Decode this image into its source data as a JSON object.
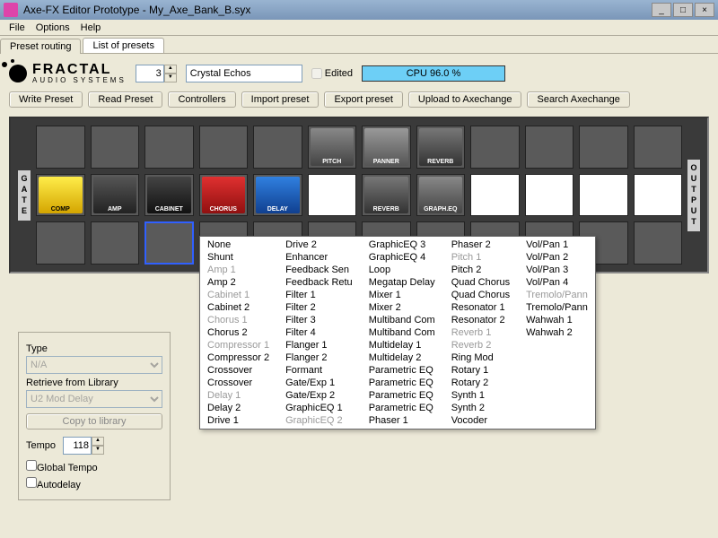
{
  "window": {
    "title": "Axe-FX Editor Prototype - My_Axe_Bank_B.syx"
  },
  "menu": [
    "File",
    "Options",
    "Help"
  ],
  "tabs": [
    "Preset routing",
    "List of presets"
  ],
  "logo": {
    "brand": "FRACTAL",
    "sub": "AUDIO SYSTEMS"
  },
  "preset": {
    "number": "3",
    "name": "Crystal Echos",
    "edited_label": "Edited",
    "edited": false
  },
  "cpu": "CPU 96.0 %",
  "buttons": [
    "Write Preset",
    "Read Preset",
    "Controllers",
    "Import preset",
    "Export preset",
    "Upload to Axechange",
    "Search Axechange"
  ],
  "routing_labels": {
    "gate": "GATE",
    "output": "OUTPUT"
  },
  "pedals": {
    "comp": "COMP",
    "amp": "AMP",
    "cab": "CABINET",
    "chorus": "CHORUS",
    "delay": "DELAY",
    "pitch": "PITCH",
    "pan": "PANNER",
    "reverb": "REVERB",
    "reverb2": "REVERB",
    "geq": "GRAPH.EQ"
  },
  "side": {
    "type_label": "Type",
    "type_value": "N/A",
    "retrieve_label": "Retrieve from Library",
    "retrieve_value": "U2 Mod Delay",
    "copy_btn": "Copy to library",
    "tempo_label": "Tempo",
    "tempo_value": "118",
    "global_tempo": "Global Tempo",
    "autodelay": "Autodelay"
  },
  "dropdown": {
    "cols": [
      [
        {
          "t": "None"
        },
        {
          "t": "Shunt"
        },
        {
          "t": "Amp 1",
          "d": 1
        },
        {
          "t": "Amp 2"
        },
        {
          "t": "Cabinet 1",
          "d": 1
        },
        {
          "t": "Cabinet 2"
        },
        {
          "t": "Chorus 1",
          "d": 1
        },
        {
          "t": "Chorus 2"
        },
        {
          "t": "Compressor 1",
          "d": 1
        },
        {
          "t": "Compressor 2"
        },
        {
          "t": "Crossover"
        },
        {
          "t": "Crossover"
        },
        {
          "t": "Delay 1",
          "d": 1
        },
        {
          "t": "Delay 2"
        },
        {
          "t": "Drive 1"
        }
      ],
      [
        {
          "t": "Drive 2"
        },
        {
          "t": "Enhancer"
        },
        {
          "t": "Feedback Sen"
        },
        {
          "t": "Feedback Retu"
        },
        {
          "t": "Filter 1"
        },
        {
          "t": "Filter 2"
        },
        {
          "t": "Filter 3"
        },
        {
          "t": "Filter 4"
        },
        {
          "t": "Flanger 1"
        },
        {
          "t": "Flanger 2"
        },
        {
          "t": "Formant"
        },
        {
          "t": "Gate/Exp 1"
        },
        {
          "t": "Gate/Exp 2"
        },
        {
          "t": "GraphicEQ 1"
        },
        {
          "t": "GraphicEQ 2",
          "d": 1
        }
      ],
      [
        {
          "t": "GraphicEQ 3"
        },
        {
          "t": "GraphicEQ 4"
        },
        {
          "t": "Loop"
        },
        {
          "t": "Megatap Delay"
        },
        {
          "t": "Mixer 1"
        },
        {
          "t": "Mixer 2"
        },
        {
          "t": "Multiband Com"
        },
        {
          "t": "Multiband Com"
        },
        {
          "t": "Multidelay 1"
        },
        {
          "t": "Multidelay 2"
        },
        {
          "t": "Parametric EQ"
        },
        {
          "t": "Parametric EQ"
        },
        {
          "t": "Parametric EQ"
        },
        {
          "t": "Parametric EQ"
        },
        {
          "t": "Phaser 1"
        }
      ],
      [
        {
          "t": "Phaser 2"
        },
        {
          "t": "Pitch 1",
          "d": 1
        },
        {
          "t": "Pitch 2"
        },
        {
          "t": "Quad Chorus"
        },
        {
          "t": "Quad Chorus"
        },
        {
          "t": "Resonator 1"
        },
        {
          "t": "Resonator 2"
        },
        {
          "t": "Reverb 1",
          "d": 1
        },
        {
          "t": "Reverb 2",
          "d": 1
        },
        {
          "t": "Ring Mod"
        },
        {
          "t": "Rotary 1"
        },
        {
          "t": "Rotary 2"
        },
        {
          "t": "Synth 1"
        },
        {
          "t": "Synth 2"
        },
        {
          "t": "Vocoder"
        }
      ],
      [
        {
          "t": "Vol/Pan 1"
        },
        {
          "t": "Vol/Pan 2"
        },
        {
          "t": "Vol/Pan 3"
        },
        {
          "t": "Vol/Pan 4"
        },
        {
          "t": "Tremolo/Pann",
          "d": 1
        },
        {
          "t": "Tremolo/Pann"
        },
        {
          "t": "Wahwah 1"
        },
        {
          "t": "Wahwah 2"
        }
      ]
    ]
  }
}
